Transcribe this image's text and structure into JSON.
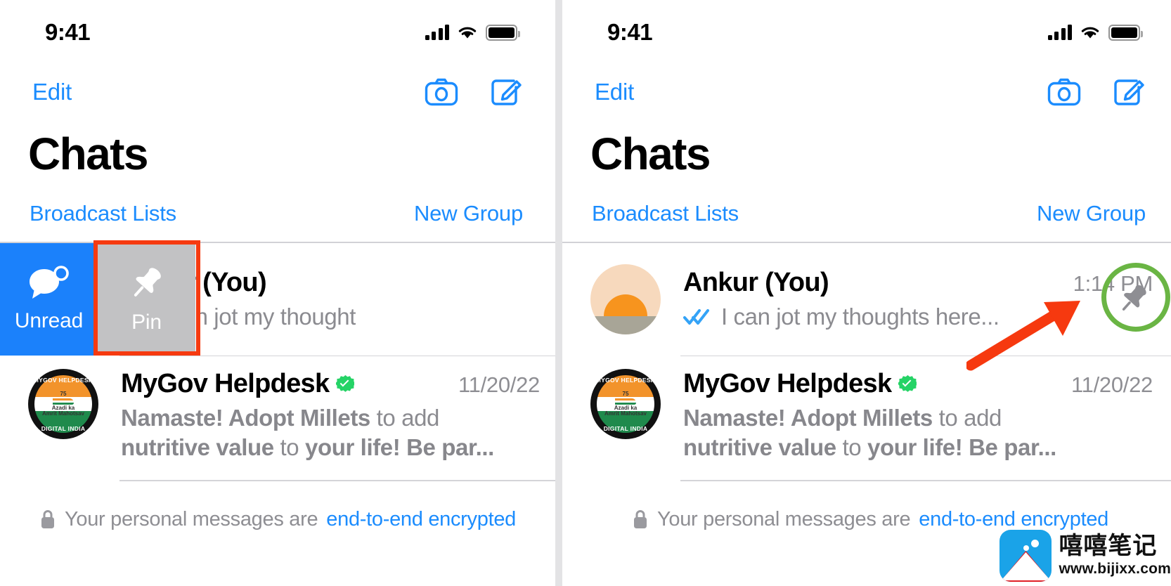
{
  "meta": {
    "accent_blue": "#1b8cfe",
    "swipe_unread_blue": "#1b81fb",
    "swipe_pin_gray": "#c2c2c4",
    "highlight_red": "#f63a10",
    "annotation_green": "#6ab544",
    "verified_green": "#25d366",
    "muted_gray": "#8e8e93"
  },
  "status_bar": {
    "time": "9:41",
    "signal_icon": "cellular-bars-icon",
    "wifi_icon": "wifi-icon",
    "battery_icon": "battery-full-icon"
  },
  "nav": {
    "edit_label": "Edit",
    "camera_icon": "camera-icon",
    "compose_icon": "compose-icon"
  },
  "header": {
    "title": "Chats",
    "broadcast_lists_label": "Broadcast Lists",
    "new_group_label": "New Group"
  },
  "swipe_actions": [
    {
      "label": "Unread",
      "icon": "unread-chat-bubble-icon",
      "color": "#1b81fb"
    },
    {
      "label": "Pin",
      "icon": "pin-icon",
      "color": "#c2c2c4"
    }
  ],
  "chats": [
    {
      "name": "Ankur (You)",
      "avatar_icon": "sunset-avatar",
      "read_receipt_icon": "double-check-blue-icon",
      "preview_left": "I can jot my thought",
      "preview_right": "I can jot my thoughts here...",
      "timestamp": "1:14 PM",
      "pin_icon": "pin-icon",
      "verified": false
    },
    {
      "name": "MyGov Helpdesk",
      "avatar_icon": "mygov-helpdesk-logo",
      "verified": true,
      "verified_icon": "verified-badge-icon",
      "timestamp": "11/20/22",
      "preview_line1_bold": "Namaste! Adopt Millets",
      "preview_line1_rest": " to add",
      "preview_line2_bold": "nutritive value",
      "preview_line2_mid": " to ",
      "preview_line2_bold2": "your life! Be par...",
      "avatar_text": {
        "ring_top": "MYGOV HELPDESK",
        "ring_bottom": "DIGITAL INDIA",
        "emblem_line1": "75",
        "emblem_line2": "Azadi ka",
        "emblem_line3": "Amrit Mahotsav"
      }
    }
  ],
  "footer": {
    "lock_icon": "lock-icon",
    "text_prefix": "Your personal messages are ",
    "link_label": "end-to-end encrypted"
  },
  "annotations": {
    "left_highlight_target": "pin-swipe-action",
    "right_circle_target": "pin-indicator",
    "arrow_icon": "red-arrow-icon"
  },
  "watermark": {
    "logo_icon": "bijixx-mountain-logo",
    "brand_cn": "嘻嘻笔记",
    "url": "www.bijixx.com"
  }
}
